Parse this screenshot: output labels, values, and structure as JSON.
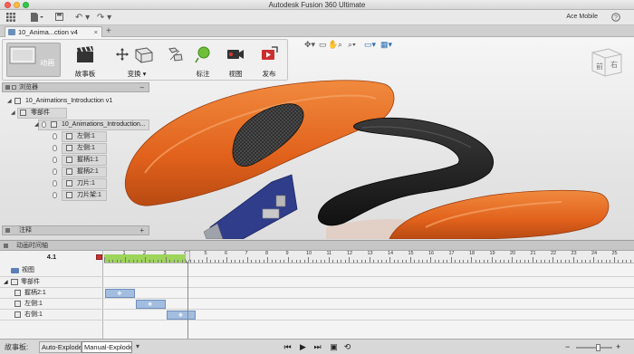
{
  "window": {
    "title": "Autodesk Fusion 360 Ultimate"
  },
  "user": {
    "name": "Ace Mobile"
  },
  "document_tab": {
    "label": "10_Anima...ction v4"
  },
  "toolbar": {
    "workspace_label": "动画",
    "storyboard_label": "故事板",
    "transform_label": "变换",
    "annotate_label": "标注",
    "view_label": "视图",
    "publish_label": "发布"
  },
  "viewcube": {
    "front": "前",
    "right": "右"
  },
  "browser": {
    "header": "浏览器",
    "root": "10_Animations_Introduction v1",
    "components_folder": "零部件",
    "assembly": "10_Animations_Introduction...",
    "items": [
      "左侧:1",
      "左侧:1",
      "握柄1:1",
      "握柄2:1",
      "刀片:1",
      "刀片架:1"
    ]
  },
  "comments": {
    "header": "注释"
  },
  "animation": {
    "header": "动画时间轴",
    "current_time": "4.1",
    "ruler_labels": [
      "1",
      "2",
      "3",
      "4",
      "5",
      "6",
      "7",
      "8",
      "9",
      "10",
      "11",
      "12",
      "13",
      "14",
      "15",
      "16",
      "17",
      "18",
      "19",
      "20",
      "21",
      "22",
      "23",
      "24",
      "25"
    ],
    "rows": [
      {
        "label": "视图"
      },
      {
        "label": "零部件"
      },
      {
        "label": "握柄2:1"
      },
      {
        "label": "左侧:1"
      },
      {
        "label": "右侧:1"
      }
    ],
    "actions": [
      {
        "row": "握柄2:1",
        "start": 0,
        "end": 1.5
      },
      {
        "row": "左侧:1",
        "start": 1.5,
        "end": 3.0
      },
      {
        "row": "右侧:1",
        "start": 3.0,
        "end": 4.5
      }
    ],
    "playhead_time": 4.1
  },
  "storyboard_bar": {
    "label": "故事板:",
    "tabs": [
      "Auto-Explode",
      "Manual-Explode"
    ],
    "active_tab": "Manual-Explode"
  },
  "colors": {
    "orange": "#e8661f",
    "black_part": "#1b1b1b",
    "blue_part": "#2f3d8a",
    "action_bar": "#a3bde0",
    "ruler_green": "#9dd45a"
  }
}
